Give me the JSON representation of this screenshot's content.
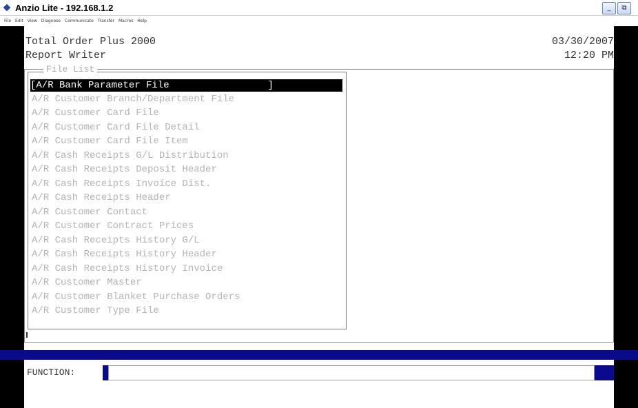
{
  "window": {
    "title": "Anzio Lite - 192.168.1.2",
    "minimize_label": "_",
    "restore_label": "⧉"
  },
  "menu": {
    "items": [
      "File",
      "Edit",
      "View",
      "Diagnose",
      "Communicate",
      "Transfer",
      "Macros",
      "Help"
    ]
  },
  "screen": {
    "app_name": "Total Order Plus 2000",
    "module": "Report Writer",
    "date": "03/30/2007",
    "time": "12:20 PM"
  },
  "file_list": {
    "title": "File List",
    "selected_index": 0,
    "items": [
      "[A/R Bank Parameter File                 ]",
      "A/R Customer Branch/Department File",
      "A/R Customer Card File",
      "A/R Customer Card File Detail",
      "A/R Customer Card File Item",
      "A/R Cash Receipts G/L Distribution",
      "A/R Cash Receipts Deposit Header",
      "A/R Cash Receipts Invoice Dist.",
      "A/R Cash Receipts Header",
      "A/R Customer Contact",
      "A/R Customer Contract Prices",
      "A/R Cash Receipts History G/L",
      "A/R Cash Receipts History Header",
      "A/R Cash Receipts History Invoice",
      "A/R Customer Master",
      "A/R Customer Blanket Purchase Orders",
      "A/R Customer Type File"
    ]
  },
  "function_bar": {
    "label": "FUNCTION:",
    "value": ""
  },
  "colors": {
    "terminal_bg": "#000000",
    "status_bar": "#0a0a8c",
    "item_text": "#b4b4b4"
  }
}
